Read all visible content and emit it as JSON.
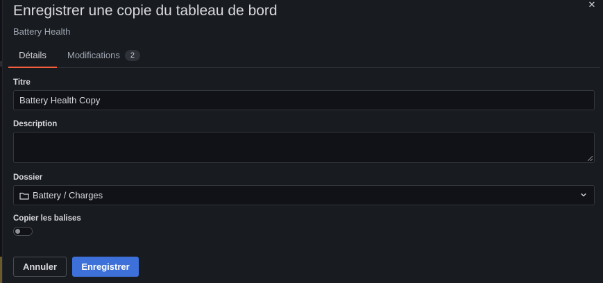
{
  "dialog": {
    "title": "Enregistrer une copie du tableau de bord",
    "subtitle": "Battery Health",
    "close_icon": "close-icon"
  },
  "tabs": [
    {
      "label": "Détails",
      "active": true
    },
    {
      "label": "Modifications",
      "count": "2",
      "active": false
    }
  ],
  "form": {
    "title_label": "Titre",
    "title_value": "Battery Health Copy",
    "description_label": "Description",
    "description_value": "",
    "folder_label": "Dossier",
    "folder_value": "Battery / Charges",
    "copy_tags_label": "Copier les balises",
    "copy_tags_enabled": false
  },
  "buttons": {
    "cancel": "Annuler",
    "save": "Enregistrer"
  },
  "colors": {
    "accent": "#f55f3e",
    "primary": "#3d71d9"
  }
}
